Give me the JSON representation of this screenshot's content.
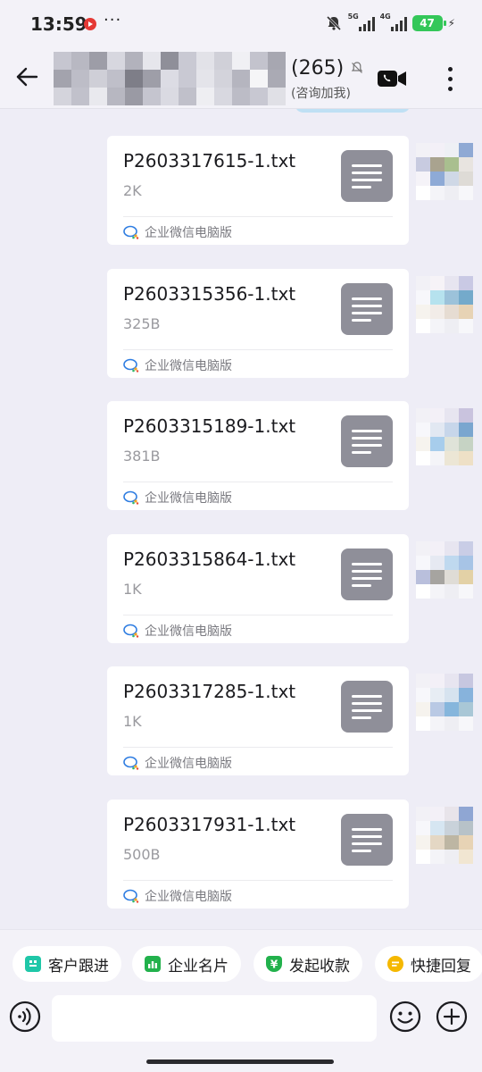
{
  "status_bar": {
    "time": "13:59",
    "more": "···",
    "signal1_tag": "5G",
    "signal2_tag": "4G",
    "battery": "47",
    "charging_icon": "bolt-icon"
  },
  "header": {
    "back_icon": "arrow-left-icon",
    "count": "(265)",
    "subtitle": "(咨询加我)",
    "mute_icon": "bell-off-icon",
    "video_icon": "video-call-icon",
    "menu_icon": "more-vertical-icon",
    "avatar_colors": [
      "#c6c6d0",
      "#b8b8c2",
      "#9d9da7",
      "#d7d7df",
      "#b2b2bc",
      "#e6e6ec",
      "#8f8f99",
      "#c9c9d3",
      "#e2e2e8",
      "#d0d0d8",
      "#f0f0f4",
      "#c3c3cd",
      "#a7a7b1",
      "#a3a3ad",
      "#bdbdc7",
      "#cfcfd7",
      "#bfbfc9",
      "#7e7e88",
      "#9e9ea8",
      "#dcdce4",
      "#c9c9d3",
      "#e4e4ea",
      "#d3d3db",
      "#b5b5bf",
      "#f5f5f7",
      "#aaaab4",
      "#d4d4dc",
      "#c1c1cb",
      "#e9e9ee",
      "#b7b7c1",
      "#9a9aa4",
      "#c5c5cf",
      "#dadae2",
      "#c0c0ca",
      "#eeeef2",
      "#d8d8e0",
      "#bcbcc6",
      "#c8c8d2",
      "#e0e0e6"
    ]
  },
  "messages": [
    {
      "file_name": "P2603317615-1.txt",
      "size": "2K",
      "source": "企业微信电脑版",
      "avatar": [
        "#f2f1f6",
        "#f3f0f7",
        "#eef0f5",
        "#8fa9d4",
        "#c8cbe0",
        "#a9a38f",
        "#a9bf8f",
        "#e8e4e0",
        "#f5f3f8",
        "#8eaad6",
        "#cfd8e6",
        "#dedbd6",
        "#ffffff",
        "#f4f4f8",
        "#eeeef3",
        "#f7f7fa"
      ]
    },
    {
      "file_name": "P2603315356-1.txt",
      "size": "325B",
      "source": "企业微信电脑版",
      "avatar": [
        "#f2f1f6",
        "#f6f3f7",
        "#e7e5f0",
        "#c9c9e4",
        "#f7f7fb",
        "#b6e2ee",
        "#9cc2da",
        "#74aacb",
        "#f6f3ee",
        "#f2ece8",
        "#e6dcd2",
        "#e7d3b5",
        "#ffffff",
        "#f4f4f8",
        "#eeeef3",
        "#f7f7fa"
      ]
    },
    {
      "file_name": "P2603315189-1.txt",
      "size": "381B",
      "source": "企业微信电脑版",
      "avatar": [
        "#f2f1f6",
        "#f3f0f7",
        "#e7e5f0",
        "#c9c3de",
        "#f7f7fb",
        "#e2e8f2",
        "#c7d6ea",
        "#7aa6cf",
        "#f6f3ee",
        "#a7cdec",
        "#dfe3d9",
        "#c6d3c4",
        "#ffffff",
        "#f4f4f8",
        "#ece6d5",
        "#eee0c6"
      ]
    },
    {
      "file_name": "P2603315864-1.txt",
      "size": "1K",
      "source": "企业微信电脑版",
      "avatar": [
        "#f2f1f6",
        "#f3f0f7",
        "#e7e5f0",
        "#c9cde6",
        "#f7f7fb",
        "#e6e9f2",
        "#bfd9ef",
        "#a7c4e6",
        "#b9bfdc",
        "#a6a4a0",
        "#dfdcd6",
        "#e3d1a6",
        "#ffffff",
        "#f4f4f8",
        "#eeeef3",
        "#f7f7fa"
      ]
    },
    {
      "file_name": "P2603317285-1.txt",
      "size": "1K",
      "source": "企业微信电脑版",
      "avatar": [
        "#f2f1f6",
        "#f3f0f7",
        "#e7e5f0",
        "#c7c7e0",
        "#f7f7fb",
        "#e7edf4",
        "#d6e3ef",
        "#87b3dc",
        "#f6f3ee",
        "#b9c9e4",
        "#86b6dc",
        "#a9c7d6",
        "#ffffff",
        "#f4f4f8",
        "#eeeef3",
        "#f7f7fa"
      ]
    },
    {
      "file_name": "P2603317931-1.txt",
      "size": "500B",
      "source": "企业微信电脑版",
      "avatar": [
        "#f2f1f6",
        "#f3f0f7",
        "#e8e4ea",
        "#8fa6d3",
        "#f7f7fb",
        "#d6e6f2",
        "#c9d2da",
        "#b7c2c8",
        "#f6f3ee",
        "#e4d7c4",
        "#bdb6a3",
        "#e7d3b5",
        "#ffffff",
        "#f4f4f8",
        "#eeeef3",
        "#f1e6d2"
      ]
    }
  ],
  "quick_actions": [
    {
      "label": "客户跟进",
      "icon": "customer-follow-icon",
      "color": "#1fc7a8"
    },
    {
      "label": "企业名片",
      "icon": "business-card-icon",
      "color": "#22b14c"
    },
    {
      "label": "发起收款",
      "icon": "payment-shield-icon",
      "color": "#22b14c"
    },
    {
      "label": "快捷回复",
      "icon": "quick-reply-icon",
      "color": "#f5b800"
    }
  ],
  "input": {
    "voice_icon": "voice-icon",
    "placeholder": "",
    "emoji_icon": "emoji-icon",
    "plus_icon": "plus-circle-icon"
  },
  "colors": {
    "background": "#eeedf6",
    "file_icon": "#8f8f99",
    "bubble": "#ffffff"
  }
}
